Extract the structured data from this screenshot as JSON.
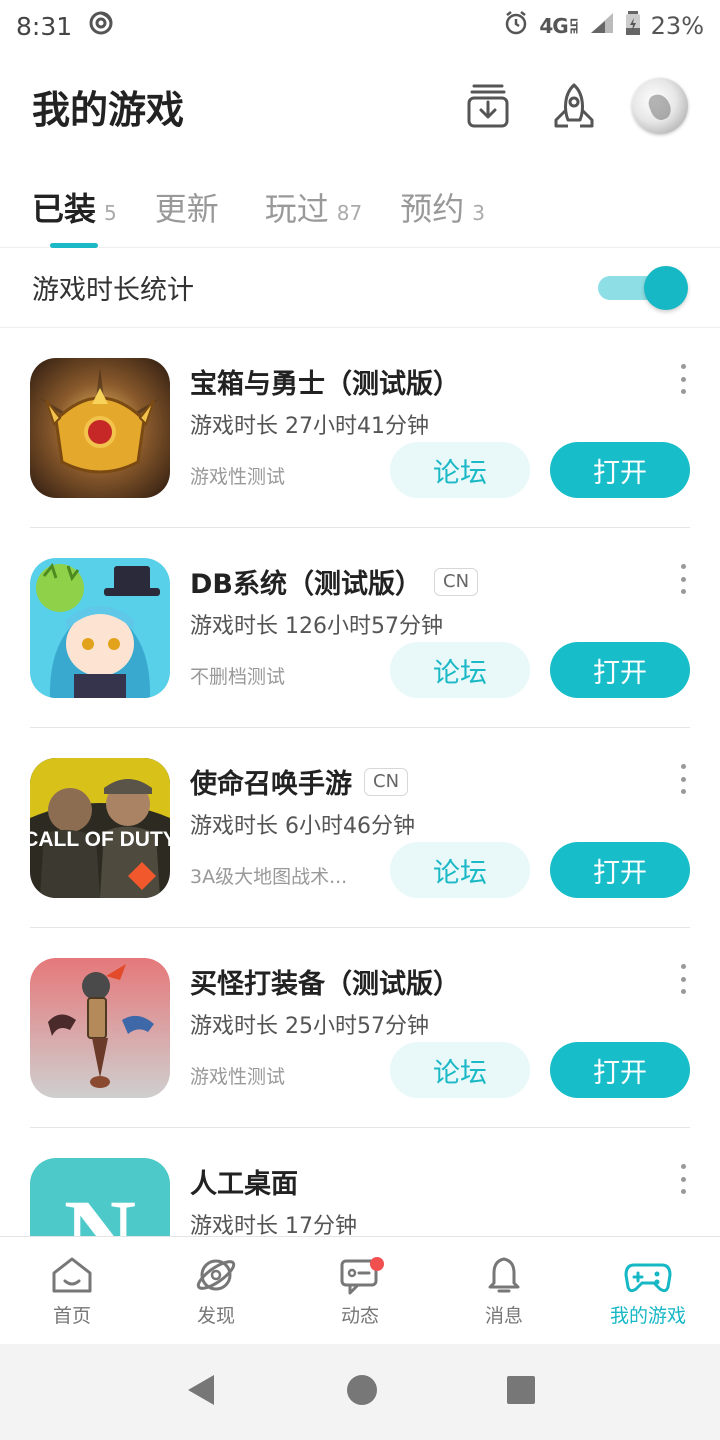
{
  "status_bar": {
    "time": "8:31",
    "network": "4G",
    "network_sub": "LTE",
    "battery_percent": "23%"
  },
  "header": {
    "title": "我的游戏"
  },
  "tabs": [
    {
      "label": "已装",
      "count": "5",
      "active": true
    },
    {
      "label": "更新",
      "count": "",
      "active": false
    },
    {
      "label": "玩过",
      "count": "87",
      "active": false
    },
    {
      "label": "预约",
      "count": "3",
      "active": false
    }
  ],
  "stats": {
    "label": "游戏时长统计",
    "toggle_on": true
  },
  "games": [
    {
      "name": "宝箱与勇士（测试版）",
      "tag": "",
      "time": "游戏时长 27小时41分钟",
      "sub": "游戏性测试",
      "forum_label": "论坛",
      "open_label": "打开"
    },
    {
      "name": "DB系统（测试版）",
      "tag": "CN",
      "time": "游戏时长 126小时57分钟",
      "sub": "不删档测试",
      "forum_label": "论坛",
      "open_label": "打开"
    },
    {
      "name": "使命召唤手游",
      "tag": "CN",
      "time": "游戏时长 6小时46分钟",
      "sub": "3A级大地图战术...",
      "forum_label": "论坛",
      "open_label": "打开",
      "icon_text": "CALL OF DUTY"
    },
    {
      "name": "买怪打装备（测试版）",
      "tag": "",
      "time": "游戏时长 25小时57分钟",
      "sub": "游戏性测试",
      "forum_label": "论坛",
      "open_label": "打开"
    },
    {
      "name": "人工桌面",
      "tag": "",
      "time": "游戏时长 17分钟",
      "sub": "",
      "forum_label": "",
      "open_label": "",
      "icon_text": "N"
    }
  ],
  "bottom_nav": [
    {
      "label": "首页",
      "icon": "home-icon",
      "active": false
    },
    {
      "label": "发现",
      "icon": "planet-icon",
      "active": false
    },
    {
      "label": "动态",
      "icon": "message-icon",
      "active": false,
      "badge": true
    },
    {
      "label": "消息",
      "icon": "bell-icon",
      "active": false
    },
    {
      "label": "我的游戏",
      "icon": "gamepad-icon",
      "active": true
    }
  ],
  "colors": {
    "accent": "#17b8c5",
    "accent_light": "#e9f8f9",
    "badge": "#f24f4f"
  }
}
